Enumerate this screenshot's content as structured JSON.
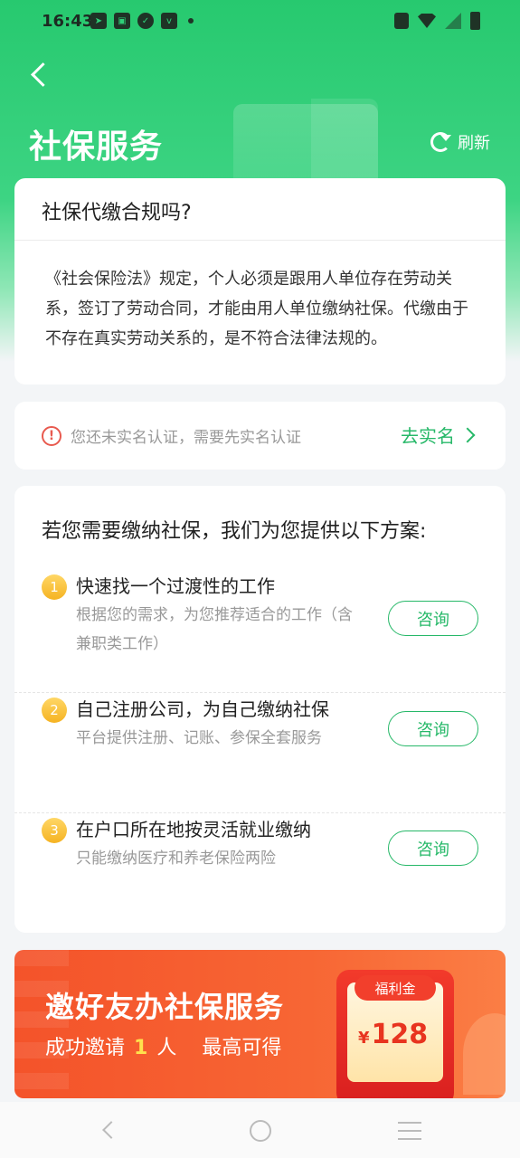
{
  "status_bar": {
    "time": "16:43"
  },
  "header": {
    "title": "社保服务",
    "refresh_label": "刷新"
  },
  "compliance_card": {
    "title": "社保代缴合规吗?",
    "body": "《社会保险法》规定，个人必须是跟用人单位存在劳动关系，签订了劳动合同，才能由用人单位缴纳社保。代缴由于不存在真实劳动关系的，是不符合法律法规的。"
  },
  "verify_card": {
    "message": "您还未实名认证，需要先实名认证",
    "action_label": "去实名"
  },
  "plans_card": {
    "heading": "若您需要缴纳社保，我们为您提供以下方案:",
    "options": [
      {
        "num": "1",
        "title": "快速找一个过渡性的工作",
        "desc": "根据您的需求，为您推荐适合的工作（含兼职类工作）",
        "button": "咨询"
      },
      {
        "num": "2",
        "title": "自己注册公司，为自己缴纳社保",
        "desc": "平台提供注册、记账、参保全套服务",
        "button": "咨询"
      },
      {
        "num": "3",
        "title": "在户口所在地按灵活就业缴纳",
        "desc": "只能缴纳医疗和养老保险两险",
        "button": "咨询"
      }
    ]
  },
  "banner": {
    "title": "邀好友办社保服务",
    "sub_prefix": "成功邀请",
    "sub_count": "1",
    "sub_unit": "人",
    "sub_suffix": "最高可得",
    "coupon_tag": "福利金",
    "coupon_currency": "¥",
    "coupon_amount": "128"
  },
  "icons": {
    "back": "chevron-left-icon",
    "refresh": "refresh-icon",
    "warning": "exclamation-circle-icon",
    "verify_arrow": "chevron-right-icon"
  },
  "colors": {
    "primary": "#26b868",
    "banner": "#f4532a",
    "badge": "#f5b322",
    "warning": "#e85a4f"
  }
}
